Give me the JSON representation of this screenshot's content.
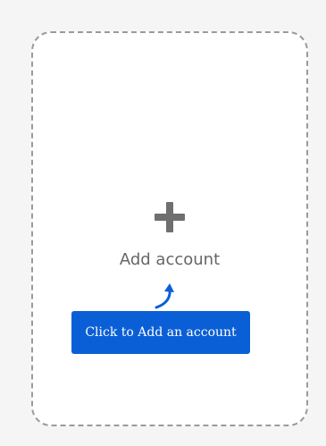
{
  "card": {
    "label": "Add account",
    "icon": "plus-icon"
  },
  "callout": {
    "text": "Click to Add an account",
    "icon": "curved-arrow-up-icon",
    "color": "#0b5fd6"
  }
}
